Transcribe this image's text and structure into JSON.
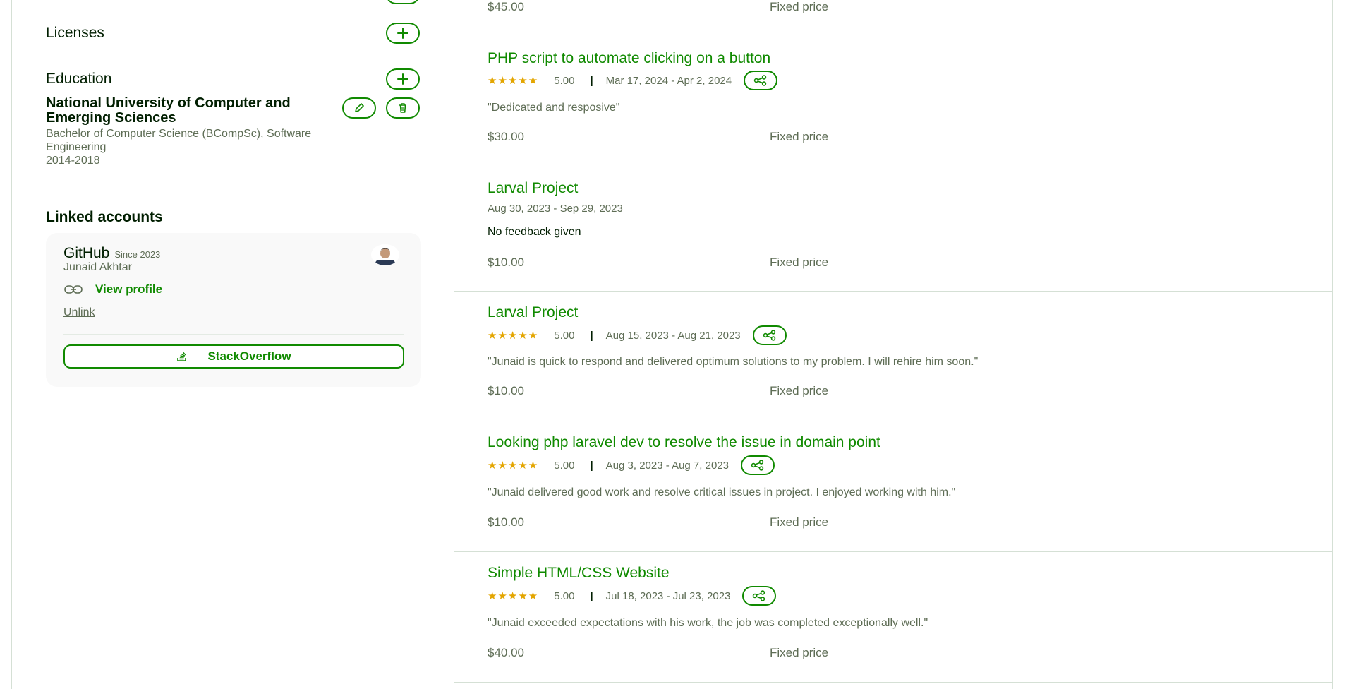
{
  "sidebar": {
    "licenses_title": "Licenses",
    "education_title": "Education",
    "education": {
      "school": "National University of Computer and Emerging Sciences",
      "degree": "Bachelor of Computer Science (BCompSc), Software Engineering",
      "years": "2014-2018"
    },
    "linked_title": "Linked accounts",
    "github": {
      "name": "GitHub",
      "since": "Since 2023",
      "user": "Junaid Akhtar",
      "view_profile": "View profile",
      "unlink": "Unlink"
    },
    "stackoverflow_label": "StackOverflow"
  },
  "jobs": [
    {
      "price": "$45.00",
      "type": "Fixed price"
    },
    {
      "title": "PHP script to automate clicking on a button",
      "rating": "5.00",
      "dates": "Mar 17, 2024 - Apr 2, 2024",
      "feedback": "\"Dedicated and resposive\"",
      "price": "$30.00",
      "type": "Fixed price"
    },
    {
      "title": "Larval Project",
      "dates": "Aug 30, 2023 - Sep 29, 2023",
      "feedback": "No feedback given",
      "price": "$10.00",
      "type": "Fixed price"
    },
    {
      "title": "Larval Project",
      "rating": "5.00",
      "dates": "Aug 15, 2023 - Aug 21, 2023",
      "feedback": "\"Junaid is quick to respond and delivered optimum solutions to my problem. I will rehire him soon.\"",
      "price": "$10.00",
      "type": "Fixed price"
    },
    {
      "title": "Looking php laravel dev to resolve the issue in domain point",
      "rating": "5.00",
      "dates": "Aug 3, 2023 - Aug 7, 2023",
      "feedback": "\"Junaid delivered good work and resolve critical issues in project. I enjoyed working with him.\"",
      "price": "$10.00",
      "type": "Fixed price"
    },
    {
      "title": "Simple HTML/CSS Website",
      "rating": "5.00",
      "dates": "Jul 18, 2023 - Jul 23, 2023",
      "feedback": "\"Junaid exceeded expectations with his work, the job was completed exceptionally well.\"",
      "price": "$40.00",
      "type": "Fixed price"
    }
  ],
  "icons": {
    "add": "plus-icon",
    "edit": "pencil-icon",
    "delete": "trash-icon",
    "share": "share-icon",
    "link": "link-icon",
    "stackoverflow": "stackoverflow-icon"
  },
  "colors": {
    "accent": "#108a00",
    "star": "#e3a500",
    "muted": "#5e6d55",
    "text": "#001e00"
  }
}
